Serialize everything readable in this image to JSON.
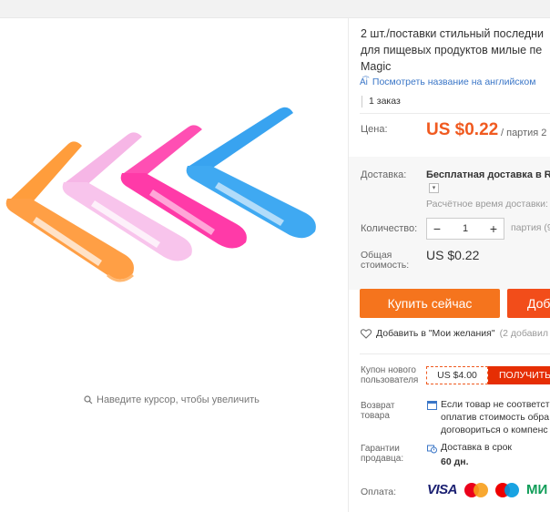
{
  "product": {
    "title_lines": [
      "2 шт./поставки стильный последни",
      "для пищевых продуктов милые пе",
      "Magic"
    ],
    "translate_link": "Посмотреть название на английском",
    "orders": "1 заказ"
  },
  "gallery": {
    "zoom_hint": "Наведите курсор, чтобы увеличить"
  },
  "price": {
    "label": "Цена:",
    "value": "US $0.22",
    "unit": "/ партия 2"
  },
  "delivery": {
    "label": "Доставка:",
    "method": "Бесплатная доставка в Ru",
    "estimate": "Расчётное время доставки:"
  },
  "quantity": {
    "label": "Количество:",
    "value": "1",
    "minus": "−",
    "plus": "+",
    "note": "партия (9"
  },
  "total": {
    "label_line1": "Общая",
    "label_line2": "стоимость:",
    "value": "US $0.22"
  },
  "actions": {
    "buy_now": "Купить сейчас",
    "add_to_cart": "Доб"
  },
  "wishlist": {
    "label": "Добавить в \"Мои желания\"",
    "count": "(2 добавил"
  },
  "coupon": {
    "label_line1": "Купон нового",
    "label_line2": "пользователя",
    "amount": "US $4.00",
    "button": "ПОЛУЧИТЬ"
  },
  "returns": {
    "label_line1": "Возврат",
    "label_line2": "товара",
    "line1": "Если товар не соответст",
    "line2": "оплатив стоимость обра",
    "line3": "договориться о компенс"
  },
  "guarantee": {
    "label_line1": "Гарантии",
    "label_line2": "продавца:",
    "text": "Доставка в срок",
    "days": "60 дн."
  },
  "payment": {
    "label": "Оплата:",
    "visa": "VISA",
    "mir": "МИ"
  },
  "colors": {
    "price": "#f05a20",
    "buy_button": "#f5741d",
    "cart_button": "#f24d1a",
    "coupon_button": "#e62e04",
    "link": "#3a76c7"
  }
}
